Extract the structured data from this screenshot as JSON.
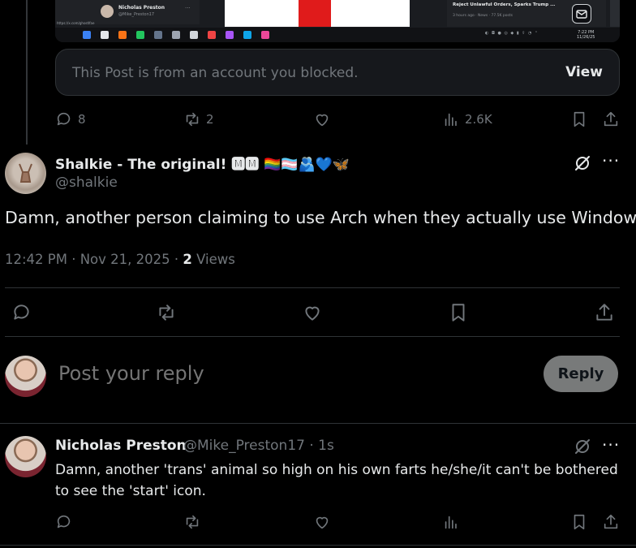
{
  "embedded_screenshot": {
    "mini_name": "Nicholas Preston",
    "mini_handle": "@Mike_Preston17",
    "url": "https://x.com/ghostlfae",
    "news_title": "Reject Unlawful Orders, Sparks Trump ...",
    "news_meta": "3 hours ago · News · 77.5K posts",
    "clock_time": "7:22 PM",
    "clock_date": "11/26/25"
  },
  "quoted": {
    "blocked_text": "This Post is from an account you blocked.",
    "view_label": "View",
    "stats": {
      "replies": "8",
      "reposts": "2",
      "likes": "",
      "views": "2.6K"
    }
  },
  "main_post": {
    "display_name": "Shalkie - The original! 🅼🅼",
    "name_emojis": "🏳️‍🌈🏳️‍⚧️🫂💙🦋",
    "handle": "@shalkie",
    "text": "Damn, another person claiming to use Arch when they actually use Windows.",
    "timestamp": "12:42 PM · Nov 21, 2025",
    "separator": " · ",
    "views_count": "2",
    "views_label": " Views"
  },
  "composer": {
    "placeholder": "Post your reply",
    "reply_label": "Reply"
  },
  "reply": {
    "display_name": "Nicholas Preston",
    "handle_time": "@Mike_Preston17 · 1s",
    "text": "Damn, another 'trans' animal so high on his own farts he/she/it can't be bothered to see the 'start' icon."
  },
  "colors": {
    "background": "#000000",
    "text": "#e7e9ea",
    "muted": "#71767b",
    "border": "#2f3336",
    "reply_button": "#787a7a"
  }
}
